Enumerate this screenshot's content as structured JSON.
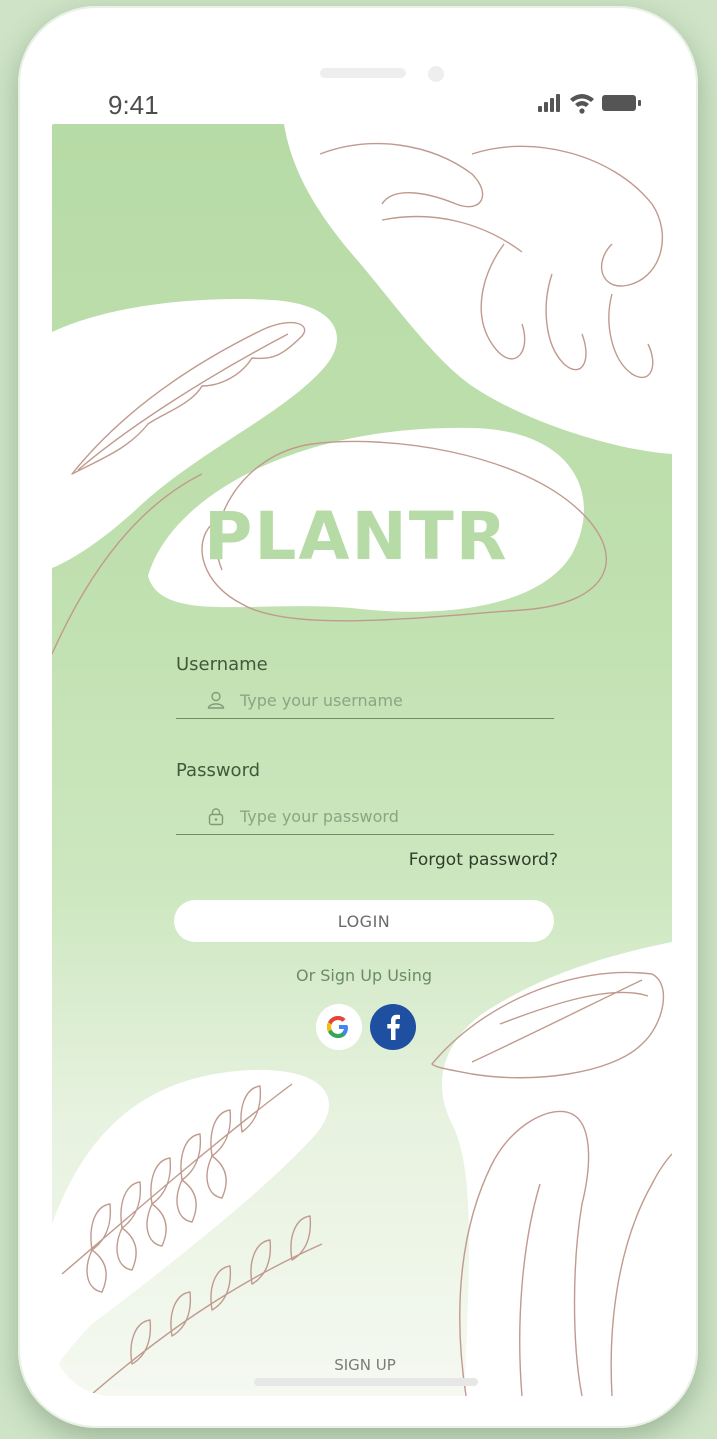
{
  "status_bar": {
    "time": "9:41",
    "signal_icon": "signal-icon",
    "wifi_icon": "wifi-icon",
    "battery_icon": "battery-icon"
  },
  "app": {
    "logo_text": "PLANTR"
  },
  "form": {
    "username": {
      "label": "Username",
      "placeholder": "Type your username",
      "icon": "user-icon"
    },
    "password": {
      "label": "Password",
      "placeholder": "Type your password",
      "icon": "lock-icon"
    },
    "forgot_label": "Forgot password?",
    "login_label": "LOGIN",
    "alt_signup_text": "Or Sign Up Using",
    "social": [
      {
        "name": "Google",
        "icon": "google-icon"
      },
      {
        "name": "Facebook",
        "icon": "facebook-icon"
      }
    ]
  },
  "footer": {
    "signup_label": "SIGN UP"
  },
  "colors": {
    "accent_green": "#b7dba6",
    "label_green": "#3f5a3a",
    "line_art": "#c09a8e",
    "facebook_blue": "#1f4fa0"
  }
}
